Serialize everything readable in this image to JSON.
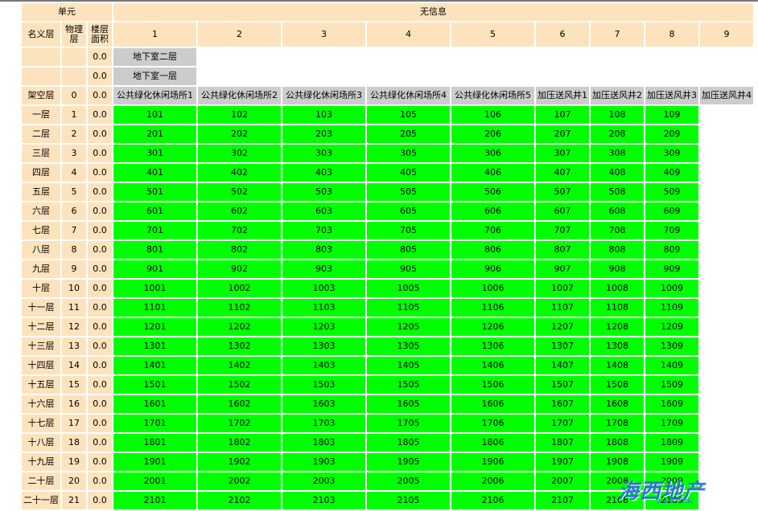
{
  "header": {
    "unit_label": "单元",
    "info_label": "无信息",
    "col_nominal": "名义层",
    "col_physical": "物理层",
    "col_area": "楼层面积",
    "columns": [
      "1",
      "2",
      "3",
      "4",
      "5",
      "6",
      "7",
      "8",
      "9"
    ]
  },
  "basement_rows": [
    {
      "area": "0.0",
      "label": "地下室二层"
    },
    {
      "area": "0.0",
      "label": "地下室一层"
    }
  ],
  "stilt_row": {
    "name": "架空层",
    "physical": "0",
    "area": "0.0",
    "cells": [
      "公共绿化休闲场所1",
      "公共绿化休闲场所2",
      "公共绿化休闲场所3",
      "公共绿化休闲场所4",
      "公共绿化休闲场所5",
      "加压送风井1",
      "加压送风井2",
      "加压送风井3",
      "加压送风井4"
    ]
  },
  "floor_rows": [
    {
      "name": "一层",
      "physical": "1",
      "area": "0.0",
      "units": [
        "101",
        "102",
        "103",
        "105",
        "106",
        "107",
        "108",
        "109"
      ]
    },
    {
      "name": "二层",
      "physical": "2",
      "area": "0.0",
      "units": [
        "201",
        "202",
        "203",
        "205",
        "206",
        "207",
        "208",
        "209"
      ]
    },
    {
      "name": "三层",
      "physical": "3",
      "area": "0.0",
      "units": [
        "301",
        "302",
        "303",
        "305",
        "306",
        "307",
        "308",
        "309"
      ]
    },
    {
      "name": "四层",
      "physical": "4",
      "area": "0.0",
      "units": [
        "401",
        "402",
        "403",
        "405",
        "406",
        "407",
        "408",
        "409"
      ]
    },
    {
      "name": "五层",
      "physical": "5",
      "area": "0.0",
      "units": [
        "501",
        "502",
        "503",
        "505",
        "506",
        "507",
        "508",
        "509"
      ]
    },
    {
      "name": "六层",
      "physical": "6",
      "area": "0.0",
      "units": [
        "601",
        "602",
        "603",
        "605",
        "606",
        "607",
        "608",
        "609"
      ]
    },
    {
      "name": "七层",
      "physical": "7",
      "area": "0.0",
      "units": [
        "701",
        "702",
        "703",
        "705",
        "706",
        "707",
        "708",
        "709"
      ]
    },
    {
      "name": "八层",
      "physical": "8",
      "area": "0.0",
      "units": [
        "801",
        "802",
        "803",
        "805",
        "806",
        "807",
        "808",
        "809"
      ]
    },
    {
      "name": "九层",
      "physical": "9",
      "area": "0.0",
      "units": [
        "901",
        "902",
        "903",
        "905",
        "906",
        "907",
        "908",
        "909"
      ]
    },
    {
      "name": "十层",
      "physical": "10",
      "area": "0.0",
      "units": [
        "1001",
        "1002",
        "1003",
        "1005",
        "1006",
        "1007",
        "1008",
        "1009"
      ]
    },
    {
      "name": "十一层",
      "physical": "11",
      "area": "0.0",
      "units": [
        "1101",
        "1102",
        "1103",
        "1105",
        "1106",
        "1107",
        "1108",
        "1109"
      ]
    },
    {
      "name": "十二层",
      "physical": "12",
      "area": "0.0",
      "units": [
        "1201",
        "1202",
        "1203",
        "1205",
        "1206",
        "1207",
        "1208",
        "1209"
      ]
    },
    {
      "name": "十三层",
      "physical": "13",
      "area": "0.0",
      "units": [
        "1301",
        "1302",
        "1303",
        "1305",
        "1306",
        "1307",
        "1308",
        "1309"
      ]
    },
    {
      "name": "十四层",
      "physical": "14",
      "area": "0.0",
      "units": [
        "1401",
        "1402",
        "1403",
        "1405",
        "1406",
        "1407",
        "1408",
        "1409"
      ]
    },
    {
      "name": "十五层",
      "physical": "15",
      "area": "0.0",
      "units": [
        "1501",
        "1502",
        "1503",
        "1505",
        "1506",
        "1507",
        "1508",
        "1509"
      ]
    },
    {
      "name": "十六层",
      "physical": "16",
      "area": "0.0",
      "units": [
        "1601",
        "1602",
        "1603",
        "1605",
        "1606",
        "1607",
        "1608",
        "1609"
      ]
    },
    {
      "name": "十七层",
      "physical": "17",
      "area": "0.0",
      "units": [
        "1701",
        "1702",
        "1703",
        "1705",
        "1706",
        "1707",
        "1708",
        "1709"
      ]
    },
    {
      "name": "十八层",
      "physical": "18",
      "area": "0.0",
      "units": [
        "1801",
        "1802",
        "1803",
        "1805",
        "1806",
        "1807",
        "1808",
        "1809"
      ]
    },
    {
      "name": "十九层",
      "physical": "19",
      "area": "0.0",
      "units": [
        "1901",
        "1902",
        "1903",
        "1905",
        "1906",
        "1907",
        "1908",
        "1909"
      ]
    },
    {
      "name": "二十层",
      "physical": "20",
      "area": "0.0",
      "units": [
        "2001",
        "2002",
        "2003",
        "2005",
        "2006",
        "2007",
        "2008",
        "2009"
      ]
    },
    {
      "name": "二十一层",
      "physical": "21",
      "area": "0.0",
      "units": [
        "2101",
        "2102",
        "2103",
        "2105",
        "2106",
        "2107",
        "2108",
        "2109"
      ]
    }
  ],
  "watermark": {
    "text": "海西地产",
    "url": "www.hxdc"
  },
  "colors": {
    "header_bg": "#fde3bd",
    "unit_green": "#00ff00",
    "basement_gray": "#cccccc"
  }
}
